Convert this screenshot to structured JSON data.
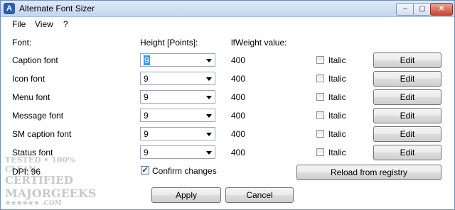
{
  "window": {
    "title": "Alternate Font Sizer",
    "icon_letter": "A"
  },
  "captions": {
    "minimize": "–",
    "maximize": "▢",
    "close": "✕"
  },
  "menu": [
    "File",
    "View",
    "?"
  ],
  "headers": {
    "font": "Font:",
    "height": "Height [Points]:",
    "weight": "lfWeight value:"
  },
  "rows": [
    {
      "label": "Caption font",
      "height": "9",
      "weight": "400",
      "italic_label": "Italic",
      "italic": false,
      "edit": "Edit"
    },
    {
      "label": "Icon font",
      "height": "9",
      "weight": "400",
      "italic_label": "Italic",
      "italic": false,
      "edit": "Edit"
    },
    {
      "label": "Menu font",
      "height": "9",
      "weight": "400",
      "italic_label": "Italic",
      "italic": false,
      "edit": "Edit"
    },
    {
      "label": "Message font",
      "height": "9",
      "weight": "400",
      "italic_label": "Italic",
      "italic": false,
      "edit": "Edit"
    },
    {
      "label": "SM caption font",
      "height": "9",
      "weight": "400",
      "italic_label": "Italic",
      "italic": false,
      "edit": "Edit"
    },
    {
      "label": "Status font",
      "height": "9",
      "weight": "400",
      "italic_label": "Italic",
      "italic": false,
      "edit": "Edit"
    }
  ],
  "dpi": "DPI: 96",
  "confirm": {
    "label": "Confirm changes",
    "checked": true
  },
  "reload_button": "Reload from registry",
  "apply_button": "Apply",
  "cancel_button": "Cancel",
  "watermark": {
    "line1": "TESTED • 100% CLEAN",
    "line2": "CERTIFIED",
    "line3": "MAJORGEEKS",
    "line4": "★★★★★★ .COM"
  }
}
